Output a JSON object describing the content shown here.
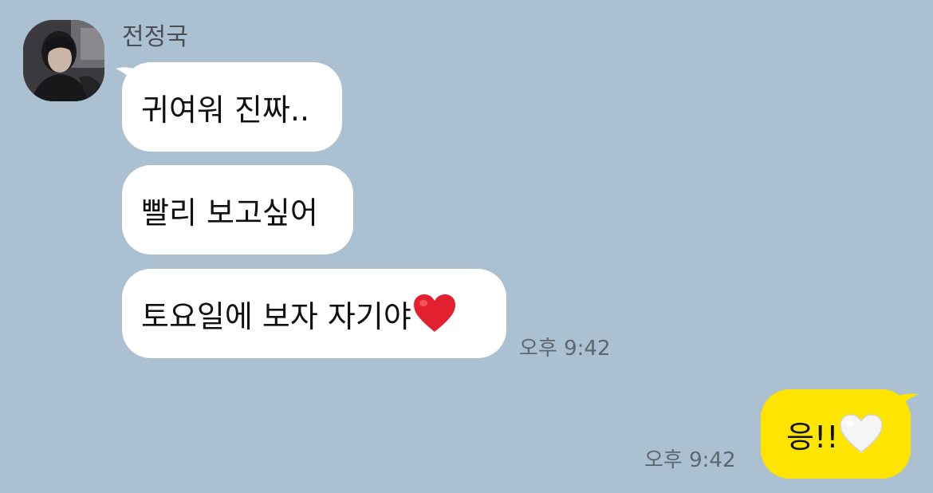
{
  "chat": {
    "sender_name": "전정국",
    "incoming": [
      {
        "text": "귀여워 진짜.."
      },
      {
        "text": "빨리 보고싶어"
      },
      {
        "text": "토요일에 보자 자기야",
        "emoji": "red-heart"
      }
    ],
    "incoming_time": "오후 9:42",
    "outgoing": [
      {
        "text": "응!!",
        "emoji": "white-heart"
      }
    ],
    "outgoing_time": "오후 9:42"
  },
  "colors": {
    "background": "#abc1d1",
    "incoming_bubble": "#ffffff",
    "outgoing_bubble": "#fee500",
    "heart_red": "#e3202e",
    "heart_white": "#f5f5f5"
  }
}
